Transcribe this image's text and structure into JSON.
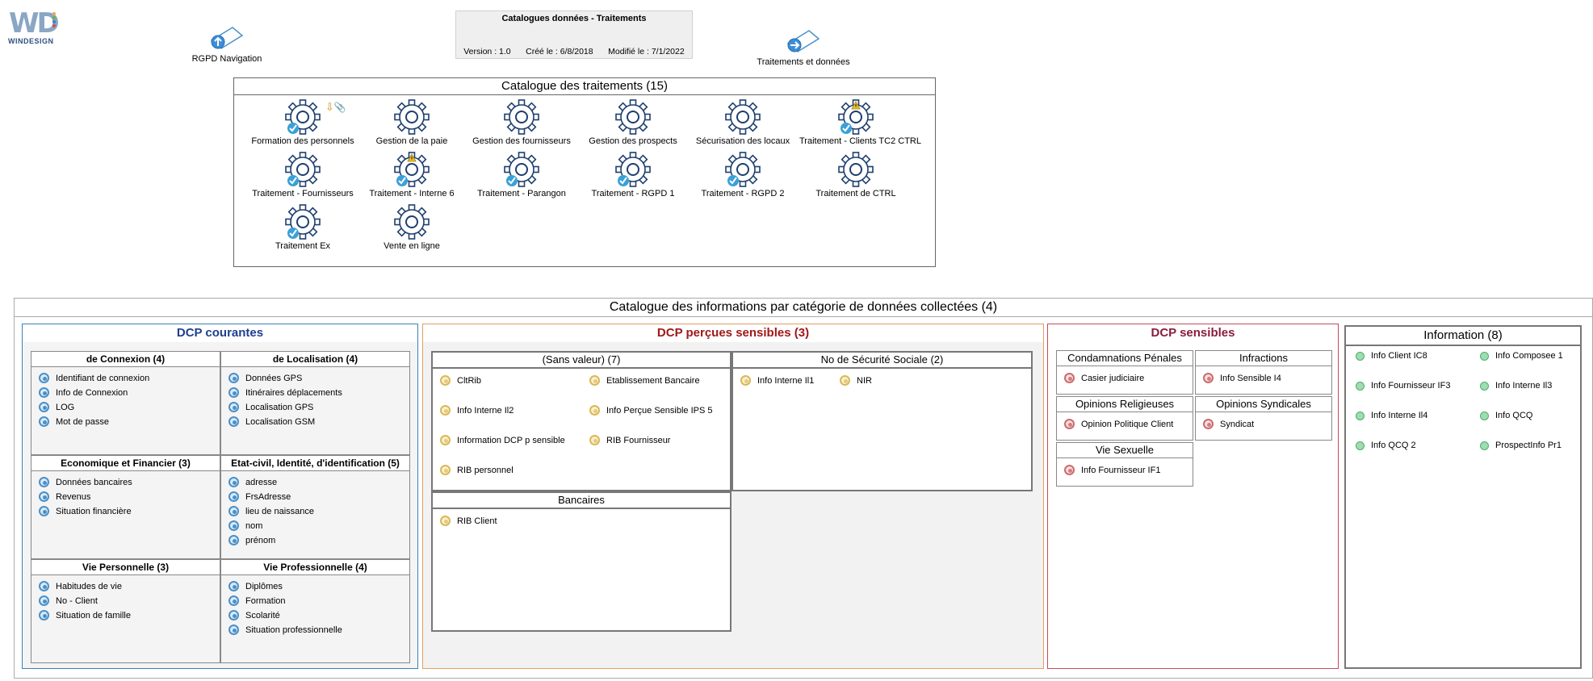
{
  "header": {
    "logo_brand": "WINDESIGN",
    "nav_left": "RGPD Navigation",
    "nav_right": "Traitements et données",
    "title": "Catalogues données - Traitements",
    "version": "Version : 1.0",
    "created": "Créé le : 6/8/2018",
    "modified": "Modifié le : 7/1/2022"
  },
  "traitements": {
    "title": "Catalogue des traitements (15)",
    "items": [
      {
        "label": "Formation des personnels",
        "check": true,
        "warn": false,
        "extra": true
      },
      {
        "label": "Gestion de la paie",
        "check": false,
        "warn": false
      },
      {
        "label": "Gestion des fournisseurs",
        "check": false,
        "warn": false
      },
      {
        "label": "Gestion des prospects",
        "check": false,
        "warn": false
      },
      {
        "label": "Sécurisation des locaux",
        "check": false,
        "warn": false
      },
      {
        "label": "Traitement - Clients TC2 CTRL",
        "check": true,
        "warn": true
      },
      {
        "label": "Traitement - Fournisseurs",
        "check": true,
        "warn": false
      },
      {
        "label": "Traitement - Interne 6",
        "check": true,
        "warn": true
      },
      {
        "label": "Traitement - Parangon",
        "check": true,
        "warn": false
      },
      {
        "label": "Traitement - RGPD 1",
        "check": true,
        "warn": false
      },
      {
        "label": "Traitement - RGPD 2",
        "check": true,
        "warn": false
      },
      {
        "label": "Traitement de CTRL",
        "check": false,
        "warn": false
      },
      {
        "label": "Traitement Ex",
        "check": true,
        "warn": false
      },
      {
        "label": "Vente en ligne",
        "check": false,
        "warn": false
      }
    ]
  },
  "informations": {
    "title": "Catalogue des informations par catégorie de données collectées (4)",
    "courantes": {
      "title": "DCP courantes",
      "groups": [
        {
          "title": "de Connexion (4)",
          "items": [
            "Identifiant de connexion",
            "Info de Connexion",
            "LOG",
            "Mot de passe"
          ]
        },
        {
          "title": "de Localisation (4)",
          "items": [
            "Données GPS",
            "Itinéraires déplacements",
            "Localisation GPS",
            "Localisation GSM"
          ]
        },
        {
          "title": "Economique et Financier (3)",
          "items": [
            "Données bancaires",
            "Revenus",
            "Situation financière"
          ]
        },
        {
          "title": "Etat-civil, Identité, d'identification (5)",
          "items": [
            "adresse",
            "FrsAdresse",
            "lieu de naissance",
            "nom",
            "prénom"
          ]
        },
        {
          "title": "Vie Personnelle (3)",
          "items": [
            "Habitudes de vie",
            "No - Client",
            "Situation de famille"
          ]
        },
        {
          "title": "Vie Professionnelle (4)",
          "items": [
            "Diplômes",
            "Formation",
            "Scolarité",
            "Situation professionnelle"
          ]
        }
      ]
    },
    "percues": {
      "title": "DCP perçues sensibles (3)",
      "sans_valeur": {
        "title": "(Sans valeur) (7)",
        "items": [
          "CltRib",
          "Etablissement Bancaire",
          "Info Interne Il2",
          "Info Perçue Sensible IPS 5",
          "Information DCP p sensible",
          "RIB Fournisseur",
          "RIB personnel"
        ]
      },
      "securite": {
        "title": "No de Sécurité Sociale (2)",
        "items": [
          "Info Interne Il1",
          "NIR"
        ]
      },
      "bancaires": {
        "title": "Bancaires",
        "items": [
          "RIB Client"
        ]
      }
    },
    "sensibles": {
      "title": "DCP sensibles",
      "groups": [
        {
          "title": "Condamnations Pénales",
          "items": [
            "Casier judiciaire"
          ]
        },
        {
          "title": "Infractions",
          "items": [
            "Info Sensible I4"
          ]
        },
        {
          "title": "Opinions Religieuses",
          "items": [
            "Opinion Politique Client"
          ]
        },
        {
          "title": "Opinions Syndicales",
          "items": [
            "Syndicat"
          ]
        },
        {
          "title": "Vie Sexuelle",
          "items": [
            "Info Fournisseur IF1"
          ]
        }
      ]
    },
    "information": {
      "title": "Information (8)",
      "items": [
        "Info Client IC8",
        "Info Composee 1",
        "Info Fournisseur IF3",
        "Info Interne Il3",
        "Info Interne Il4",
        "Info QCQ",
        "Info QCQ 2",
        "ProspectInfo Pr1"
      ]
    }
  },
  "colors": {
    "courantes": "#3b82b8",
    "percues": "#e0a060",
    "sensibles": "#c44a5a",
    "information": "#444444",
    "courantes_title": "#1f3f8f",
    "percues_title": "#a01818",
    "sensibles_title": "#8a1c3c"
  }
}
